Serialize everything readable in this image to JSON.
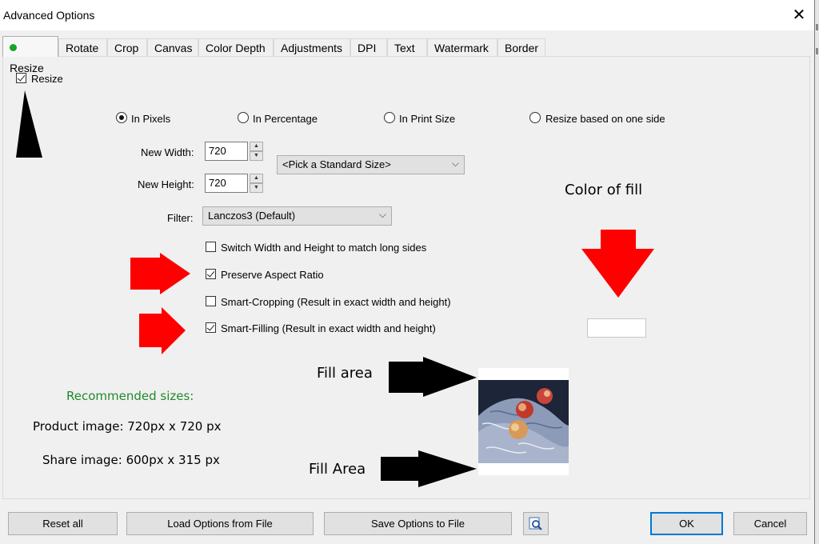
{
  "window": {
    "title": "Advanced Options",
    "close_icon": "close-icon"
  },
  "tabs": [
    {
      "label": "Resize",
      "active": true
    },
    {
      "label": "Rotate"
    },
    {
      "label": "Crop"
    },
    {
      "label": "Canvas"
    },
    {
      "label": "Color Depth"
    },
    {
      "label": "Adjustments"
    },
    {
      "label": "DPI"
    },
    {
      "label": "Text"
    },
    {
      "label": "Watermark"
    },
    {
      "label": "Border"
    }
  ],
  "resize": {
    "enable_label": "Resize",
    "enable_checked": true,
    "modes": [
      {
        "label": "In Pixels",
        "selected": true
      },
      {
        "label": "In Percentage",
        "selected": false
      },
      {
        "label": "In Print Size",
        "selected": false
      },
      {
        "label": "Resize based on one side",
        "selected": false
      }
    ],
    "width_label": "New Width:",
    "width_value": "720",
    "height_label": "New Height:",
    "height_value": "720",
    "standard_size": "<Pick a Standard Size>",
    "filter_label": "Filter:",
    "filter_value": "Lanczos3 (Default)",
    "options": [
      {
        "label": "Switch Width and Height to match long sides",
        "checked": false
      },
      {
        "label": "Preserve Aspect Ratio",
        "checked": true
      },
      {
        "label": "Smart-Cropping (Result in exact width and height)",
        "checked": false
      },
      {
        "label": "Smart-Filling (Result in exact width and height)",
        "checked": true
      }
    ],
    "fill_color": "#ffffff"
  },
  "annotations": {
    "color_of_fill": "Color of fill",
    "fill_area_1": "Fill area",
    "fill_area_2": "Fill Area",
    "recommended": "Recommended sizes:",
    "product": "Product image: 720px x 720 px",
    "share": "Share image:  600px x 315 px"
  },
  "buttons": {
    "reset": "Reset all",
    "load": "Load Options from File",
    "save": "Save Options to File",
    "preview_icon": "magnifier-icon",
    "ok": "OK",
    "cancel": "Cancel"
  },
  "colors": {
    "accent": "#0078d7",
    "active_dot": "#1aa32b",
    "recommended_text": "#1f8a2a",
    "arrow_red": "#ff0000"
  }
}
